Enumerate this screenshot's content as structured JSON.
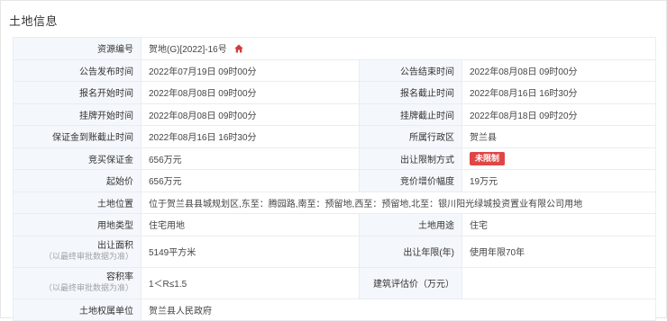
{
  "section": {
    "title": "土地信息"
  },
  "rows": {
    "resource_no": {
      "label": "资源编号",
      "value": "贺地(G)[2022]-16号"
    },
    "announce_start": {
      "label": "公告发布时间",
      "value": "2022年07月19日 09时00分"
    },
    "announce_end": {
      "label": "公告结束时间",
      "value": "2022年08月08日 09时00分"
    },
    "signup_start": {
      "label": "报名开始时间",
      "value": "2022年08月08日 09时00分"
    },
    "signup_end": {
      "label": "报名截止时间",
      "value": "2022年08月16日 16时30分"
    },
    "listing_start": {
      "label": "挂牌开始时间",
      "value": "2022年08月08日 09时00分"
    },
    "listing_end": {
      "label": "挂牌截止时间",
      "value": "2022年08月18日 09时20分"
    },
    "deposit_deadline": {
      "label": "保证金到账截止时间",
      "value": "2022年08月16日 16时30分"
    },
    "district": {
      "label": "所属行政区",
      "value": "贺兰县"
    },
    "bid_deposit": {
      "label": "竞买保证金",
      "value": "656万元"
    },
    "restriction": {
      "label": "出让限制方式",
      "value": "未限制"
    },
    "start_price": {
      "label": "起始价",
      "value": "656万元"
    },
    "increment": {
      "label": "竞价增价幅度",
      "value": "19万元"
    },
    "location": {
      "label": "土地位置",
      "value": "位于贺兰县县城规划区,东至：腾园路,南至：预留地,西至：预留地,北至：银川阳光绿城投资置业有限公司用地"
    },
    "land_type": {
      "label": "用地类型",
      "value": "住宅用地"
    },
    "land_use": {
      "label": "土地用途",
      "value": "住宅"
    },
    "area": {
      "label": "出让面积",
      "note": "（以最终审批数据为准）",
      "value": "5149平方米"
    },
    "term": {
      "label": "出让年限(年)",
      "value": "使用年限70年"
    },
    "plot_ratio": {
      "label": "容积率",
      "note": "（以最终审批数据为准）",
      "value": "1＜R≤1.5"
    },
    "valuation": {
      "label": "建筑评估价（万元）",
      "value": ""
    },
    "owner": {
      "label": "土地权属单位",
      "value": "贺兰县人民政府"
    }
  },
  "colors": {
    "label_bg": "#f4f7fb",
    "border": "#e9edf2",
    "badge": "#e04646",
    "home_icon": "#d33a3a"
  },
  "icons": {
    "resource_icon": "home-icon"
  }
}
